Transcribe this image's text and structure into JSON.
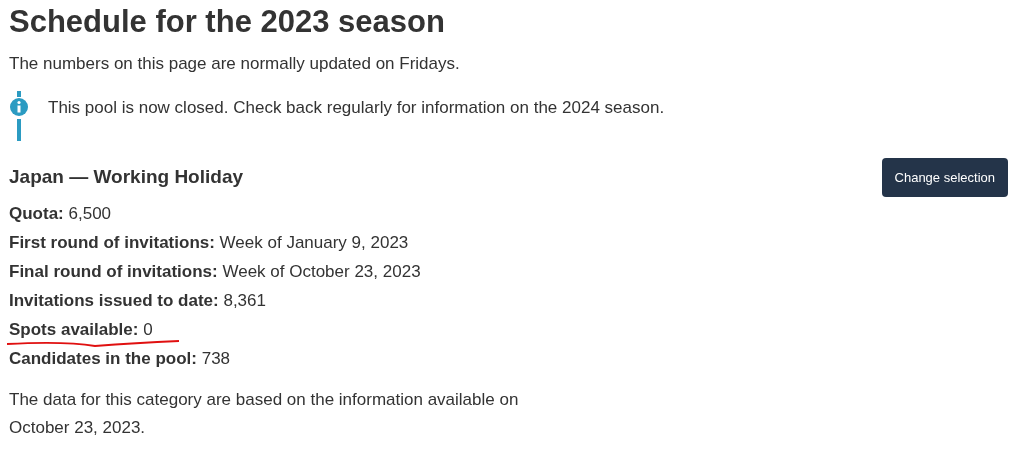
{
  "title": "Schedule for the 2023 season",
  "intro": "The numbers on this page are normally updated on Fridays.",
  "notice": "This pool is now closed. Check back regularly for information on the 2024 season.",
  "category": {
    "heading": "Japan — Working Holiday",
    "button": "Change selection"
  },
  "stats": [
    {
      "text": "**Quota:** 6,500",
      "underlined": false
    },
    {
      "text": "**First round of invitations:** Week of January 9, 2023",
      "underlined": false
    },
    {
      "text": "**Final round of invitations:** Week of October 23, 2023",
      "underlined": false
    },
    {
      "text": "**Invitations issued to date:** 8,361",
      "underlined": false
    },
    {
      "text": "**Spots available:** 0",
      "underlined": true
    },
    {
      "text": "**Candidates in the pool:** 738",
      "underlined": false
    }
  ],
  "footnote": [
    "The data for this category are based on the information available on",
    "October 23, 2023."
  ]
}
